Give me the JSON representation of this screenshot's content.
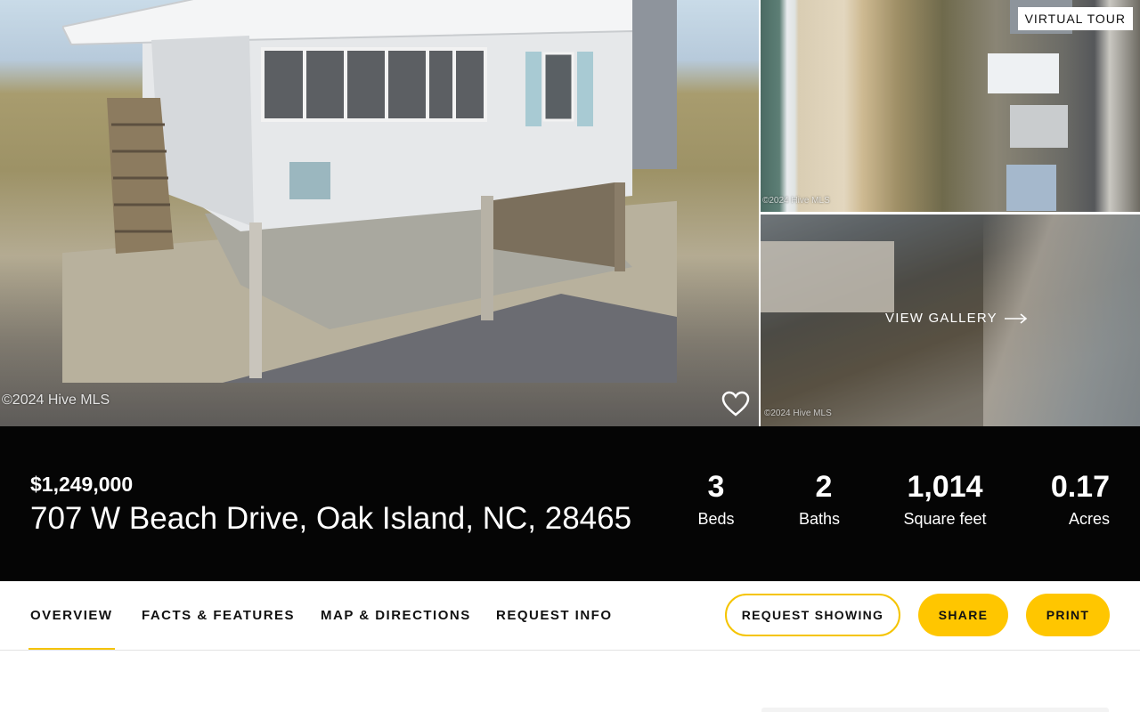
{
  "gallery": {
    "main_watermark": "©2024 Hive MLS",
    "aerial_watermark": "©2024 Hive MLS",
    "beach_watermark": "©2024 Hive MLS",
    "virtual_tour_label": "VIRTUAL TOUR",
    "view_gallery_label": "VIEW GALLERY",
    "favorite_icon": "heart-outline-icon",
    "arrow_icon": "arrow-right-icon"
  },
  "listing": {
    "price": "$1,249,000",
    "address": "707 W Beach Drive, Oak Island, NC, 28465",
    "stats": [
      {
        "value": "3",
        "label": "Beds"
      },
      {
        "value": "2",
        "label": "Baths"
      },
      {
        "value": "1,014",
        "label": "Square feet"
      },
      {
        "value": "0.17",
        "label": "Acres"
      }
    ]
  },
  "nav": {
    "tabs": [
      {
        "label": "OVERVIEW",
        "active": true
      },
      {
        "label": "FACTS & FEATURES",
        "active": false
      },
      {
        "label": "MAP & DIRECTIONS",
        "active": false
      },
      {
        "label": "REQUEST INFO",
        "active": false
      }
    ],
    "request_showing_label": "REQUEST SHOWING",
    "share_label": "SHARE",
    "print_label": "PRINT"
  },
  "colors": {
    "accent": "#ffc600",
    "info_bar_bg": "#050505",
    "text": "#111111"
  }
}
